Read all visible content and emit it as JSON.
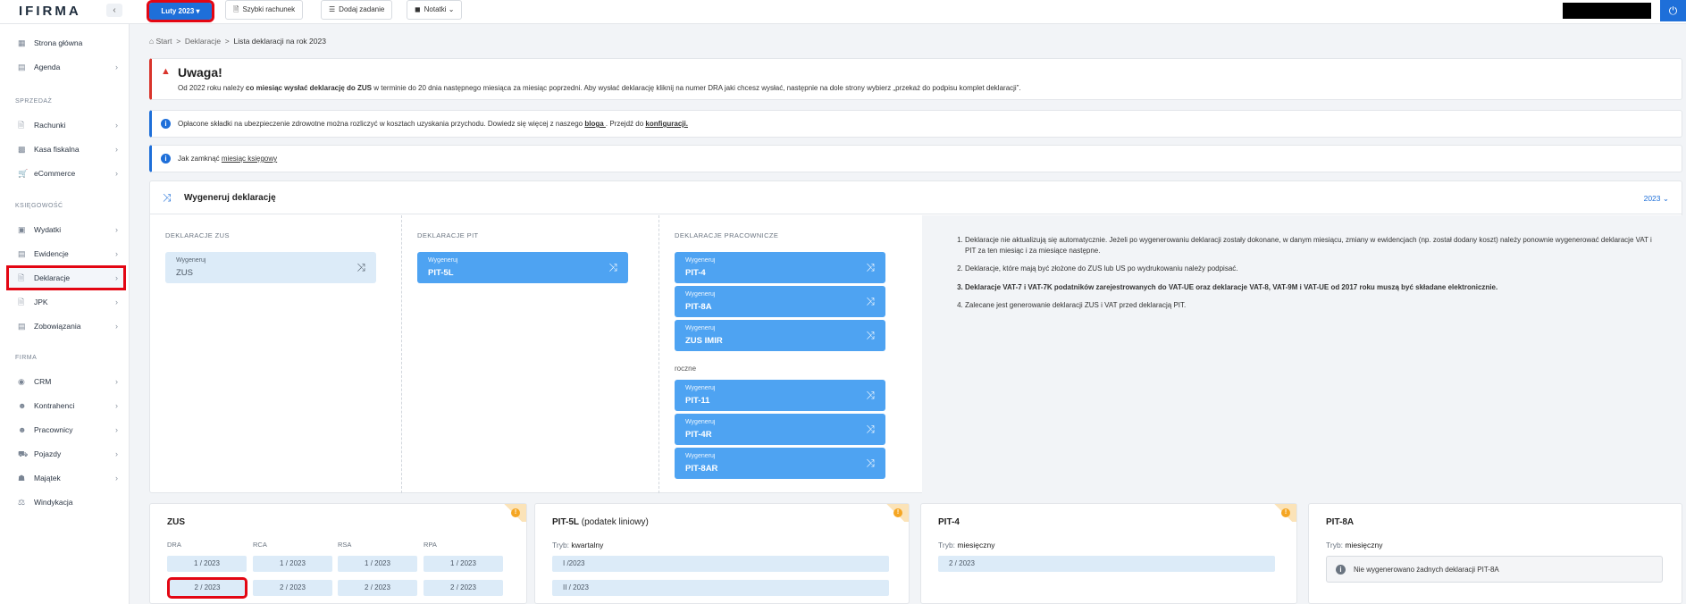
{
  "app": {
    "logo": "IFIRMA"
  },
  "topbar": {
    "month_label": "Luty 2023",
    "buttons": [
      {
        "label": "Szybki rachunek",
        "icon": "receipt-icon"
      },
      {
        "label": "Dodaj zadanie",
        "icon": "tasks-icon"
      },
      {
        "label": "Notatki",
        "icon": "note-icon"
      }
    ]
  },
  "sidebar": {
    "top_items": [
      {
        "label": "Strona główna",
        "icon": "dashboard-icon"
      },
      {
        "label": "Agenda",
        "icon": "calendar-icon"
      }
    ],
    "sections": [
      {
        "title": "SPRZEDAŻ",
        "items": [
          {
            "label": "Rachunki",
            "icon": "document-icon"
          },
          {
            "label": "Kasa fiskalna",
            "icon": "cash-register-icon"
          },
          {
            "label": "eCommerce",
            "icon": "cart-icon"
          }
        ]
      },
      {
        "title": "KSIĘGOWOŚĆ",
        "items": [
          {
            "label": "Wydatki",
            "icon": "wallet-icon"
          },
          {
            "label": "Ewidencje",
            "icon": "ledger-icon"
          },
          {
            "label": "Deklaracje",
            "icon": "declaration-icon"
          },
          {
            "label": "JPK",
            "icon": "jpk-icon"
          },
          {
            "label": "Zobowiązania",
            "icon": "obligations-icon"
          }
        ]
      },
      {
        "title": "FIRMA",
        "items": [
          {
            "label": "CRM",
            "icon": "crm-icon"
          },
          {
            "label": "Kontrahenci",
            "icon": "contractors-icon"
          },
          {
            "label": "Pracownicy",
            "icon": "employees-icon"
          },
          {
            "label": "Pojazdy",
            "icon": "truck-icon"
          },
          {
            "label": "Majątek",
            "icon": "assets-icon"
          },
          {
            "label": "Windykacja",
            "icon": "scales-icon"
          }
        ]
      }
    ]
  },
  "breadcrumb": {
    "start": "Start",
    "mid": "Deklaracje",
    "current": "Lista deklaracji na rok 2023"
  },
  "warning": {
    "title": "Uwaga!",
    "text_a": "Od 2022 roku należy ",
    "text_bold": "co miesiąc wysłać deklarację do ZUS",
    "text_b": " w terminie do 20 dnia następnego miesiąca za miesiąc poprzedni. Aby wysłać deklarację kliknij na numer DRA jaki chcesz wysłać, następnie na dole strony wybierz „przekaż do podpisu komplet deklaracji”."
  },
  "info1": {
    "text": "Opłacone składki na ubezpieczenie zdrowotne można rozliczyć w kosztach uzyskania przychodu. Dowiedz się więcej z naszego ",
    "link1": "bloga ",
    "mid": ". Przejdź do ",
    "link2": "konfiguracji."
  },
  "info2": {
    "text": "Jak zamknąć ",
    "link": "miesiąc księgowy"
  },
  "generate": {
    "title": "Wygeneruj deklarację",
    "year": "2023",
    "btn_sub": "Wygeneruj",
    "zus": {
      "header": "DEKLARACJE ZUS",
      "items": [
        "ZUS"
      ]
    },
    "pit": {
      "header": "DEKLARACJE PIT",
      "items": [
        "PIT-5L"
      ]
    },
    "emp": {
      "header": "DEKLARACJE PRACOWNICZE",
      "items": [
        "PIT-4",
        "PIT-8A",
        "ZUS IMIR"
      ],
      "annual_label": "roczne",
      "annual": [
        "PIT-11",
        "PIT-4R",
        "PIT-8AR"
      ]
    },
    "notes": [
      "Deklaracje nie aktualizują się automatycznie. Jeżeli po wygenerowaniu deklaracji zostały dokonane, w danym miesiącu, zmiany w ewidencjach (np. został dodany koszt) należy ponownie wygenerować deklaracje VAT i PIT za ten miesiąc i za miesiące następne.",
      "Deklaracje, które mają być złożone do ZUS lub US po wydrukowaniu należy podpisać.",
      "Deklaracje VAT-7 i VAT-7K podatników zarejestrowanych do VAT-UE oraz deklaracje VAT-8, VAT-9M i VAT-UE od 2017 roku muszą być składane elektronicznie.",
      "Zalecane jest generowanie deklaracji ZUS i VAT przed deklaracją PIT."
    ]
  },
  "cards": {
    "zus": {
      "title": "ZUS",
      "cols": [
        "DRA",
        "RCA",
        "RSA",
        "RPA"
      ],
      "rows": [
        [
          "1 / 2023",
          "1 / 2023",
          "1 / 2023",
          "1 / 2023"
        ],
        [
          "2 / 2023",
          "2 / 2023",
          "2 / 2023",
          "2 / 2023"
        ]
      ]
    },
    "pit5l": {
      "title": "PIT-5L",
      "suffix": " (podatek liniowy)",
      "tryb_label": "Tryb: ",
      "tryb": "kwartalny",
      "items": [
        "I /2023",
        "II / 2023"
      ]
    },
    "pit4": {
      "title": "PIT-4",
      "tryb_label": "Tryb: ",
      "tryb": "miesięczny",
      "items": [
        "2 / 2023"
      ]
    },
    "pit8a": {
      "title": "PIT-8A",
      "tryb_label": "Tryb: ",
      "tryb": "miesięczny",
      "empty": "Nie wygenerowano żadnych deklaracji PIT-8A"
    }
  }
}
